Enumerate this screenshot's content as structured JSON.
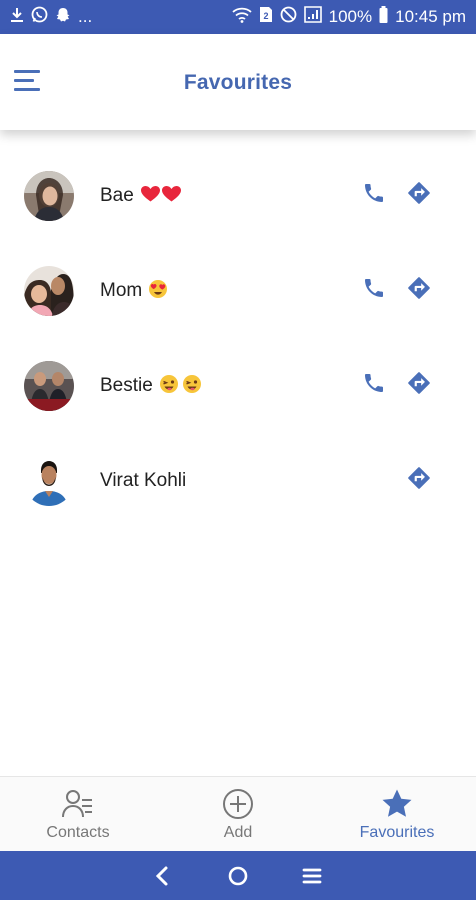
{
  "colors": {
    "status_bar": "#3d5ab3",
    "accent": "#4a6fb8",
    "title": "#4567b0",
    "inactive": "#777777",
    "system_nav": "#3d5ab3"
  },
  "status_bar": {
    "left_icons": [
      "download-icon",
      "whatsapp-icon",
      "snapchat-icon"
    ],
    "overflow": "...",
    "right_icons": [
      "wifi-icon",
      "sim-icon",
      "do-not-disturb-icon",
      "signal-icon"
    ],
    "battery": "100%",
    "time": "10:45 pm"
  },
  "header": {
    "title": "Favourites",
    "menu_icon": "hamburger-menu-icon"
  },
  "favourites": [
    {
      "name": "Bae",
      "emoji": "❤️❤️",
      "has_call": true,
      "has_directions": true
    },
    {
      "name": "Mom",
      "emoji": "😍",
      "has_call": true,
      "has_directions": true
    },
    {
      "name": "Bestie",
      "emoji": "😜😜",
      "has_call": true,
      "has_directions": true
    },
    {
      "name": "Virat Kohli",
      "emoji": "",
      "has_call": false,
      "has_directions": true
    }
  ],
  "bottom_nav": {
    "contacts": {
      "label": "Contacts",
      "icon": "contacts-icon"
    },
    "add": {
      "label": "Add",
      "icon": "add-circle-icon"
    },
    "favourites": {
      "label": "Favourites",
      "icon": "star-icon",
      "active": true
    }
  },
  "system_nav": {
    "back_icon": "back-chevron-icon",
    "home_icon": "home-circle-icon",
    "recents_icon": "recents-menu-icon"
  }
}
